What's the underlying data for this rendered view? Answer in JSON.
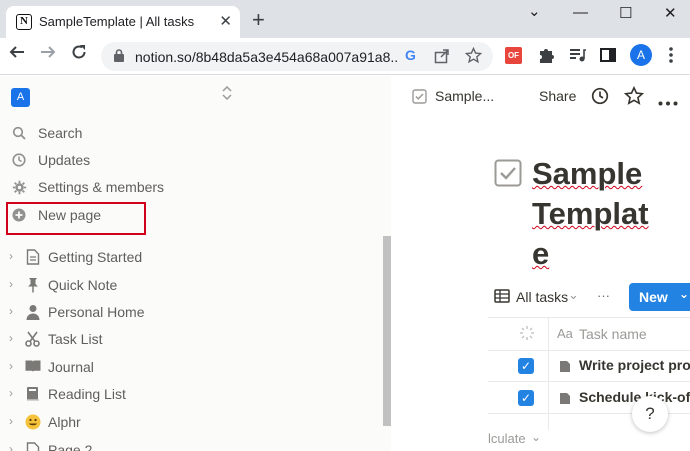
{
  "browser": {
    "tab_title": "SampleTemplate | All tasks",
    "tab_favicon_letter": "N",
    "tab_close": "✕",
    "new_tab": "+",
    "window_controls": {
      "chevron": "⌄",
      "minimize": "—",
      "maximize": "☐",
      "close": "✕"
    },
    "url": "notion.so/8b48da5a3e454a68a007a91a8...",
    "profile_initial": "A",
    "ext_badge": "OF",
    "accent": "#1a73e8"
  },
  "sidebar": {
    "workspace_initial": "A",
    "top_items": [
      {
        "label": "Search",
        "icon": "search-icon"
      },
      {
        "label": "Updates",
        "icon": "clock-icon"
      },
      {
        "label": "Settings & members",
        "icon": "gear-icon"
      },
      {
        "label": "New page",
        "icon": "plus-circle-icon"
      }
    ],
    "pages": [
      {
        "label": "Getting Started",
        "icon": "document-icon"
      },
      {
        "label": "Quick Note",
        "icon": "pin-icon"
      },
      {
        "label": "Personal Home",
        "icon": "person-icon"
      },
      {
        "label": "Task List",
        "icon": "scissors-icon"
      },
      {
        "label": "Journal",
        "icon": "book-icon"
      },
      {
        "label": "Reading List",
        "icon": "books-icon"
      },
      {
        "label": "Alphr",
        "icon": "smiley-icon"
      },
      {
        "label": "Page 2",
        "icon": "document-icon"
      }
    ]
  },
  "main": {
    "breadcrumb": "Sample...",
    "share_label": "Share",
    "title": "SampleTemplate",
    "view_label": "All tasks",
    "more": "···",
    "new_label": "New",
    "column_header": "Task name",
    "column_prefix": "Aa",
    "rows": [
      {
        "checked": true,
        "name": "Write project pro"
      },
      {
        "checked": true,
        "name": "Schedule kick-of"
      }
    ],
    "footer_label": "lculate",
    "help_label": "?"
  }
}
